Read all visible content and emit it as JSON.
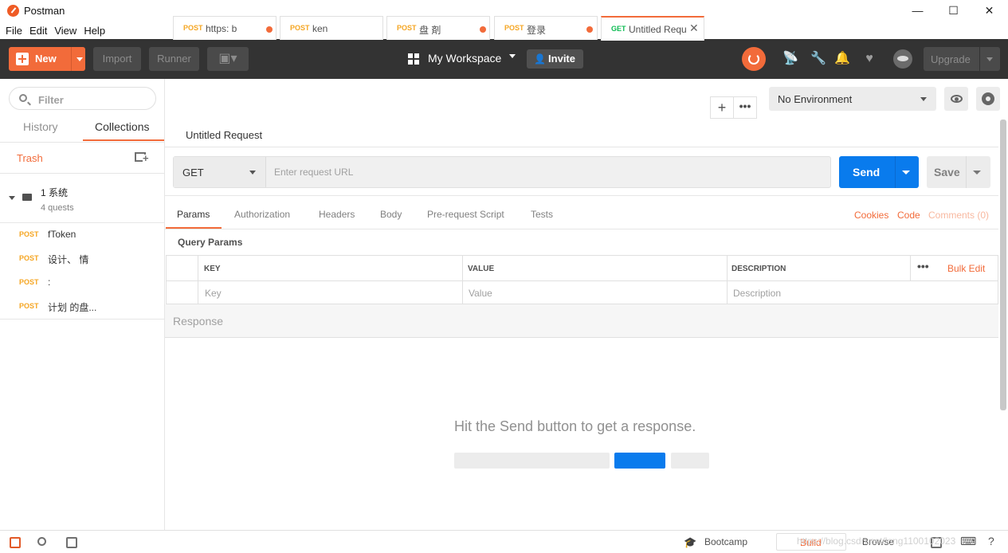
{
  "window": {
    "title": "Postman",
    "controls": {
      "minimize": "—",
      "maximize": "☐",
      "close": "✕"
    }
  },
  "menu": [
    "File",
    "Edit",
    "View",
    "Help"
  ],
  "header": {
    "new_label": "New",
    "import_label": "Import",
    "runner_label": "Runner",
    "workspace": "My Workspace",
    "invite": "Invite",
    "upgrade": "Upgrade"
  },
  "sidebar": {
    "filter_placeholder": "Filter",
    "tabs": [
      "History",
      "Collections"
    ],
    "active_tab": "Collections",
    "trash": "Trash",
    "collection": {
      "name": "1  系统",
      "subtitle": "4   quests"
    },
    "requests": [
      {
        "method": "POST",
        "name": "fToken"
      },
      {
        "method": "POST",
        "name": "  设计、 情"
      },
      {
        "method": "POST",
        "name": "  :"
      },
      {
        "method": "POST",
        "name": "  计划    的盘..."
      }
    ]
  },
  "tabs": [
    {
      "method": "POST",
      "name": "https:  b",
      "unsaved": true
    },
    {
      "method": "POST",
      "name": "     ken",
      "unsaved": false
    },
    {
      "method": "POST",
      "name": "盘       剤",
      "unsaved": true
    },
    {
      "method": "POST",
      "name": "登录",
      "unsaved": true
    },
    {
      "method": "GET",
      "name": "Untitled Requ",
      "active": true
    }
  ],
  "environment": {
    "selected": "No Environment"
  },
  "request": {
    "name": "Untitled Request",
    "method": "GET",
    "url_placeholder": "Enter request URL",
    "send": "Send",
    "save": "Save",
    "subtabs": [
      "Params",
      "Authorization",
      "Headers",
      "Body",
      "Pre-request Script",
      "Tests"
    ],
    "active_subtab": "Params",
    "links": [
      "Cookies",
      "Code",
      "Comments (0)"
    ],
    "query_params_title": "Query Params",
    "table": {
      "headers": [
        "KEY",
        "VALUE",
        "DESCRIPTION"
      ],
      "placeholders": [
        "Key",
        "Value",
        "Description"
      ],
      "bulk_edit": "Bulk Edit"
    }
  },
  "response": {
    "title": "Response",
    "empty_message": "Hit the Send button to get a response."
  },
  "footer": {
    "bootcamp": "Bootcamp",
    "build": "Build",
    "browse": "Browse",
    "watermark": "https://blog.csdn.net/long1100102023"
  },
  "colors": {
    "accent": "#f26b3a",
    "send": "#097bed",
    "header_bg": "#333333",
    "get_method": "#0cbb52",
    "post_method": "#f5a623"
  }
}
